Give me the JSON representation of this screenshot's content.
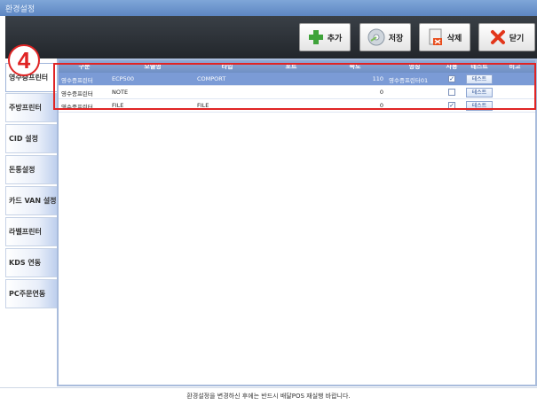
{
  "window": {
    "title": "환경설정"
  },
  "toolbar": {
    "add": "추가",
    "save": "저장",
    "delete": "삭제",
    "close": "닫기"
  },
  "sidebar": {
    "items": [
      "영수증프린터",
      "주방프린터",
      "CID 설정",
      "돈통설정",
      "카드 VAN 설정",
      "라벨프린터",
      "KDS 연동",
      "PC주문연동"
    ]
  },
  "table": {
    "columns": [
      "구분",
      "모델명",
      "타입",
      "포트",
      "속도",
      "명칭",
      "사용",
      "테스트",
      "비고"
    ],
    "rows": [
      {
        "type": "영수증프린터",
        "model": "ECP500",
        "conn": "COMPORT",
        "port": "",
        "speed": "110",
        "name": "영수증프린터01",
        "use": true,
        "test": "테스트",
        "note": ""
      },
      {
        "type": "영수증프린터",
        "model": "NOTE",
        "conn": "",
        "port": "",
        "speed": "0",
        "name": "",
        "use": false,
        "test": "테스트",
        "note": ""
      },
      {
        "type": "영수증프린터",
        "model": "FILE",
        "conn": "FILE",
        "port": "",
        "speed": "0",
        "name": "",
        "use": true,
        "test": "테스트",
        "note": ""
      }
    ]
  },
  "footer": {
    "message": "환경설정을 변경하신 후에는 반드시 배달POS 재실행 바랍니다."
  },
  "annotation": {
    "number": "4",
    "color": "#e02424"
  },
  "icons": {
    "add": "plus-icon",
    "save": "disc-icon",
    "delete": "delete-doc-icon",
    "close": "close-x-icon"
  }
}
